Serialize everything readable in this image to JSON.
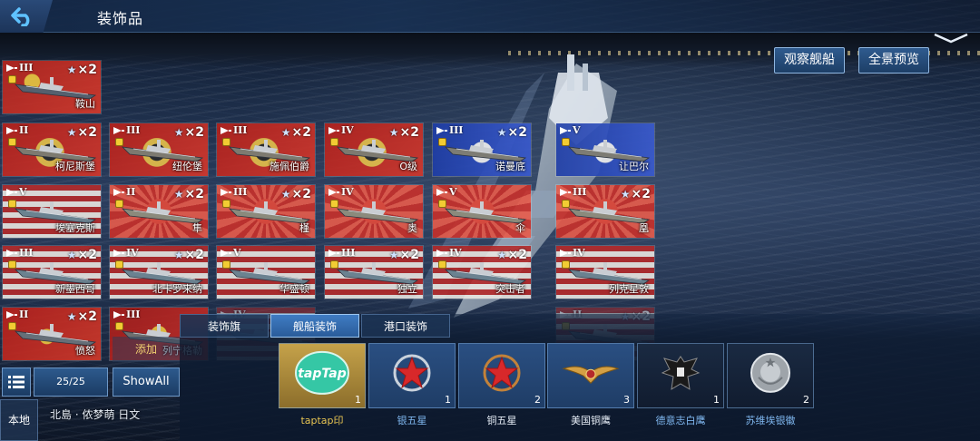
{
  "header": {
    "title": "装饰品"
  },
  "actions": {
    "observe": "观察舰船",
    "panorama": "全景预览"
  },
  "ships": [
    {
      "id": "anshan",
      "tier": "III",
      "multiplier": "×2",
      "name": "鞍山",
      "flag": "china"
    },
    {
      "id": "konigsberg",
      "tier": "II",
      "multiplier": "×2",
      "name": "柯尼斯堡",
      "flag": "germany"
    },
    {
      "id": "nurnberg",
      "tier": "III",
      "multiplier": "×2",
      "name": "纽伦堡",
      "flag": "germany"
    },
    {
      "id": "graf-spee",
      "tier": "III",
      "multiplier": "×2",
      "name": "施佩伯爵",
      "flag": "germany"
    },
    {
      "id": "o-class",
      "tier": "IV",
      "multiplier": "×2",
      "name": "O级",
      "flag": "germany"
    },
    {
      "id": "normandie",
      "tier": "III",
      "multiplier": "×2",
      "name": "诺曼底",
      "flag": "france"
    },
    {
      "id": "jean-bart",
      "tier": "V",
      "multiplier": "",
      "name": "让巴尔",
      "flag": "france"
    },
    {
      "id": "essex",
      "tier": "V",
      "multiplier": "",
      "name": "埃塞克斯",
      "flag": "usa"
    },
    {
      "id": "hayabusa",
      "tier": "II",
      "multiplier": "×2",
      "name": "隼",
      "flag": "japan"
    },
    {
      "id": "mogami",
      "tier": "III",
      "multiplier": "×2",
      "name": "槿",
      "flag": "japan"
    },
    {
      "id": "oku",
      "tier": "IV",
      "multiplier": "",
      "name": "奥",
      "flag": "japan"
    },
    {
      "id": "kasa",
      "tier": "V",
      "multiplier": "",
      "name": "伞",
      "flag": "japan"
    },
    {
      "id": "ho",
      "tier": "III",
      "multiplier": "×2",
      "name": "凰",
      "flag": "japan"
    },
    {
      "id": "new-mexico",
      "tier": "III",
      "multiplier": "×2",
      "name": "新墨西哥",
      "flag": "usa"
    },
    {
      "id": "north-carolina",
      "tier": "IV",
      "multiplier": "×2",
      "name": "北卡罗来纳",
      "flag": "usa"
    },
    {
      "id": "washington",
      "tier": "V",
      "multiplier": "",
      "name": "华盛顿",
      "flag": "usa"
    },
    {
      "id": "independence",
      "tier": "III",
      "multiplier": "×2",
      "name": "独立",
      "flag": "usa"
    },
    {
      "id": "ranger",
      "tier": "IV",
      "multiplier": "×2",
      "name": "突击者",
      "flag": "usa"
    },
    {
      "id": "lexington",
      "tier": "IV",
      "multiplier": "",
      "name": "列克星敦",
      "flag": "usa"
    },
    {
      "id": "fury",
      "tier": "II",
      "multiplier": "×2",
      "name": "愤怒",
      "flag": "uk"
    },
    {
      "id": "leningrad",
      "tier": "III",
      "multiplier": "",
      "name": "列宁格勒",
      "flag": "ussr"
    },
    {
      "id": "ghost-1",
      "tier": "IV",
      "multiplier": "",
      "name": "",
      "flag": "usa"
    },
    {
      "id": "ghost-2",
      "tier": "II",
      "multiplier": "×2",
      "name": "",
      "flag": "usa"
    }
  ],
  "left_controls": {
    "count": "25/25",
    "show_all": "ShowAll",
    "local": "本地",
    "user": "北島 · 侬梦萌 日文",
    "add": "添加"
  },
  "tabs": [
    {
      "label": "装饰旗",
      "active": false
    },
    {
      "label": "舰船装饰",
      "active": true
    },
    {
      "label": "港口装饰",
      "active": false
    }
  ],
  "decorations": [
    {
      "label": "taptap印",
      "qty": "1",
      "icon": "taptap-icon",
      "style": "gold",
      "label_color": "gold"
    },
    {
      "label": "银五星",
      "qty": "1",
      "icon": "silver-star-icon",
      "style": "blue",
      "label_color": "blue"
    },
    {
      "label": "铜五星",
      "qty": "2",
      "icon": "bronze-star-icon",
      "style": "blue",
      "label_color": "white"
    },
    {
      "label": "美国铜鹰",
      "qty": "3",
      "icon": "us-eagle-icon",
      "style": "blue",
      "label_color": "white"
    },
    {
      "label": "德意志白鹰",
      "qty": "1",
      "icon": "german-eagle-icon",
      "style": "dark",
      "label_color": "blue"
    },
    {
      "label": "苏维埃银徽",
      "qty": "2",
      "icon": "soviet-emblem-icon",
      "style": "dark",
      "label_color": "blue"
    }
  ]
}
